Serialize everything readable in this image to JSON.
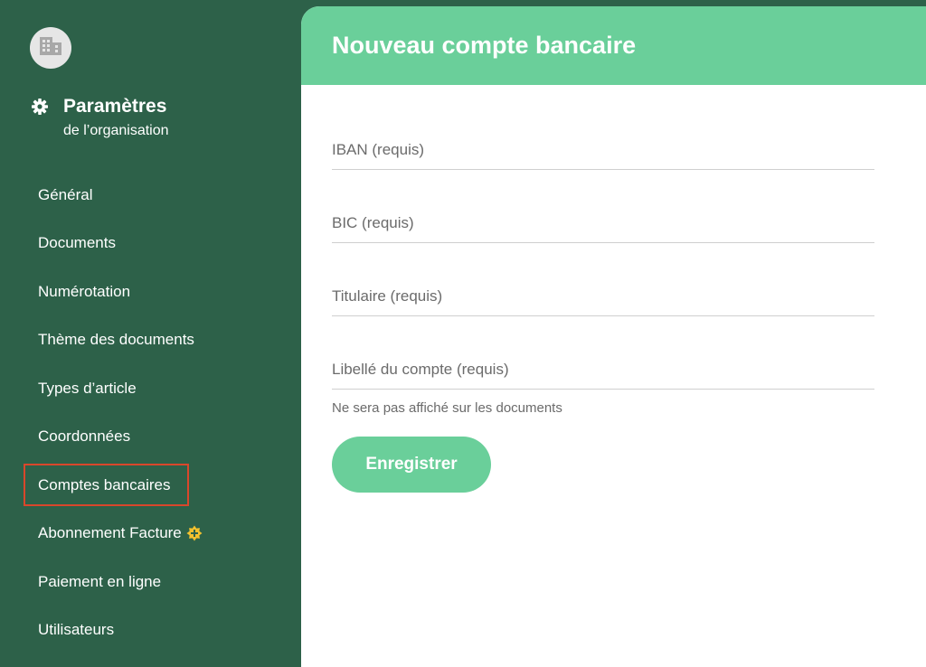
{
  "sidebar": {
    "avatar_icon": "building-icon",
    "settings_icon": "gear-icon",
    "title": "Paramètres",
    "subtitle": "de l’organisation",
    "items": [
      {
        "label": "Général",
        "active": false
      },
      {
        "label": "Documents",
        "active": false
      },
      {
        "label": "Numérotation",
        "active": false
      },
      {
        "label": "Thème des documents",
        "active": false
      },
      {
        "label": "Types d’article",
        "active": false
      },
      {
        "label": "Coordonnées",
        "active": false
      },
      {
        "label": "Comptes bancaires",
        "active": true
      },
      {
        "label": "Abonnement Facture",
        "active": false,
        "badge_icon": "star-plus-icon"
      },
      {
        "label": "Paiement en ligne",
        "active": false
      },
      {
        "label": "Utilisateurs",
        "active": false
      }
    ]
  },
  "main": {
    "title": "Nouveau compte bancaire",
    "fields": [
      {
        "label": "IBAN (requis)",
        "value": ""
      },
      {
        "label": "BIC (requis)",
        "value": ""
      },
      {
        "label": "Titulaire (requis)",
        "value": ""
      },
      {
        "label": "Libellé du compte (requis)",
        "value": ""
      }
    ],
    "hint": "Ne sera pas affiché sur les documents",
    "save_label": "Enregistrer"
  },
  "colors": {
    "sidebar_bg": "#2d6149",
    "accent": "#6acf9a",
    "highlight_border": "#d9472b",
    "badge": "#f2c12e"
  }
}
